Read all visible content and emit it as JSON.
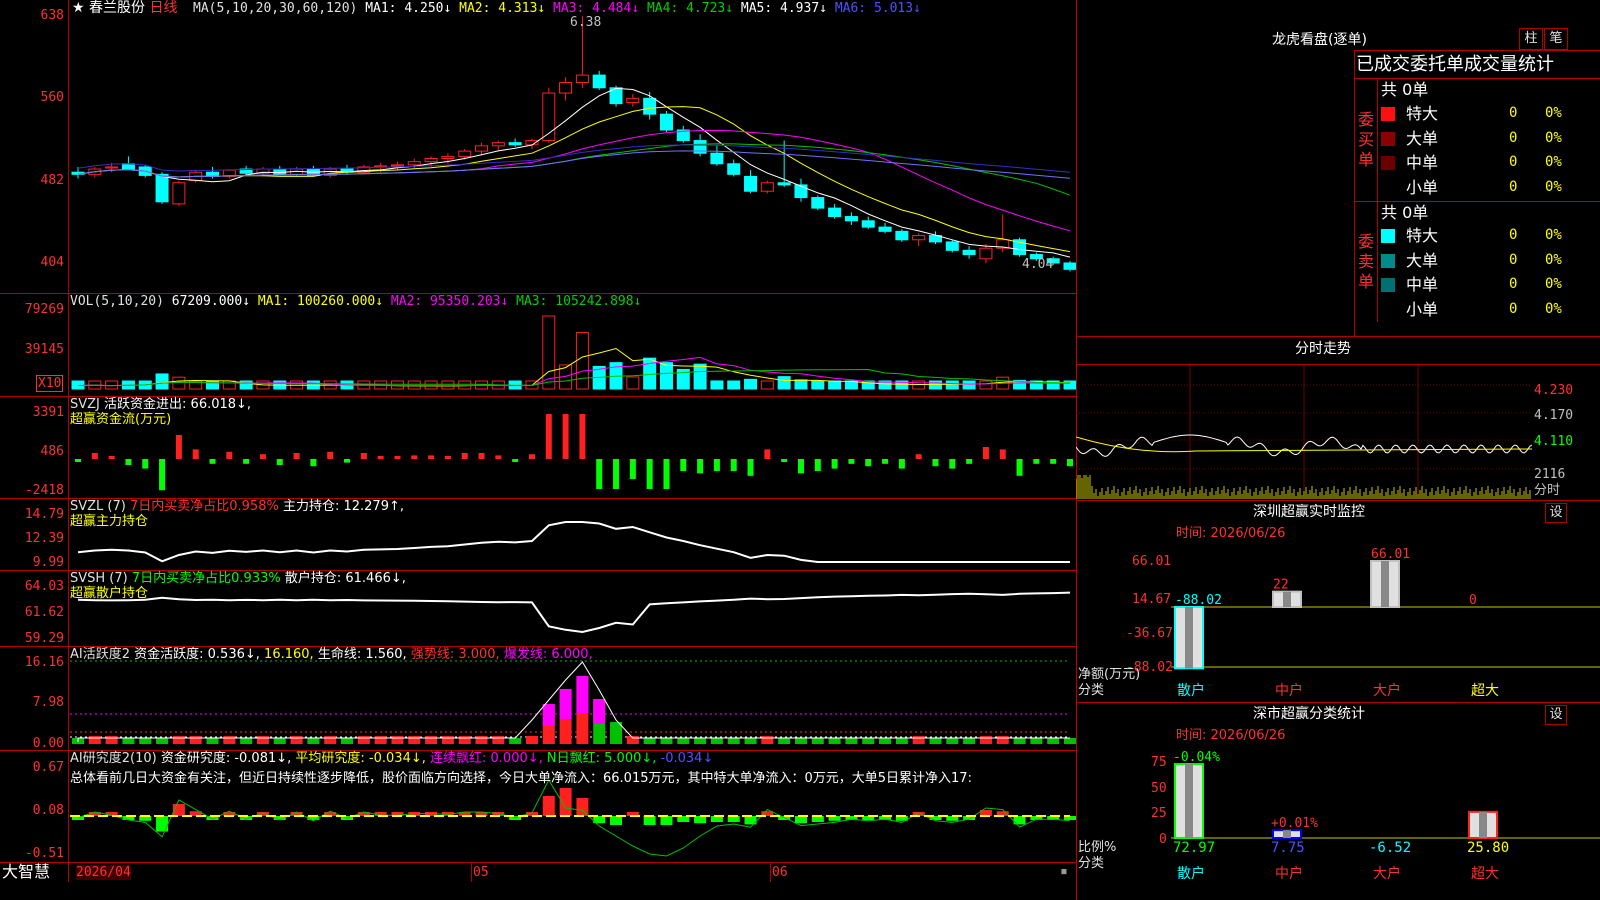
{
  "colors": {
    "up": "#ff2020",
    "down": "#00ffff",
    "ma1": "#ffffff",
    "ma2": "#ffff00",
    "ma3": "#ff00ff",
    "ma4": "#00c000",
    "ma5": "#7070ff",
    "frame": "#b00000"
  },
  "main": {
    "star": "★",
    "stock_name": "春兰股份",
    "period": "日线",
    "ma_params": "MA(5,10,20,30,60,120)",
    "ma_values": [
      "MA1: 4.250↓",
      "MA2: 4.313↓",
      "MA3: 4.484↓",
      "MA4: 4.723↓",
      "MA5: 4.937↓",
      "MA6: 5.013↓"
    ],
    "high_label": "6.38",
    "low_label": "4.04",
    "yticks": [
      "638",
      "560",
      "482",
      "404"
    ]
  },
  "vol": {
    "title": "VOL(5,10,20)",
    "value": "67209.000↓",
    "ma": [
      "MA1: 100260.000↓",
      "MA2: 95350.203↓",
      "MA3: 105242.898↓"
    ],
    "yticks": [
      "79269",
      "39145"
    ],
    "multiplier": "X10"
  },
  "svzj": {
    "title": "SVZJ",
    "label": "活跃资金进出: 66.018↓,",
    "sub": "超赢资金流(万元)",
    "yticks": [
      "3391",
      "486",
      "-2418"
    ]
  },
  "svzl": {
    "title": "SVZL (7)",
    "ratio": "7日内买卖净占比0.958%",
    "label": "主力持仓: 12.279↑,",
    "sub": "超赢主力持仓",
    "yticks": [
      "14.79",
      "12.39",
      "9.99"
    ]
  },
  "svsh": {
    "title": "SVSH (7)",
    "ratio": "7日内买卖净占比0.933%",
    "label": "散户持仓: 61.466↓,",
    "sub": "超赢散户持仓",
    "yticks": [
      "64.03",
      "61.62",
      "59.29"
    ]
  },
  "ai_active": {
    "title": "AI活跃度2",
    "label": "资金活跃度: 0.536↓,",
    "v2": "16.160,",
    "life": "生命线: 1.560,",
    "strong": "强势线: 3.000,",
    "burst": "爆发线: 6.000,",
    "yticks": [
      "16.16",
      "7.98",
      "0.00"
    ]
  },
  "ai_research": {
    "title": "AI研究度2(10)",
    "label": "资金研究度: -0.081↓,",
    "avg": "平均研究度: -0.034↓,",
    "cont": "连续飘红: 0.000↓,",
    "nday": "N日飘红: 5.000↓,",
    "last": "-0.034↓",
    "summary": "总体看前几日大资金有关注，但近日持续性逐步降低，股价面临方向选择，今日大单净流入：66.015万元，其中特大单净流入：0万元，大单5日累计净入17:",
    "yticks": [
      "0.67",
      "0.08",
      "-0.51"
    ]
  },
  "bottom": {
    "brand": "大智慧",
    "date": "2026/04",
    "m1": "05",
    "m2": "06"
  },
  "right": {
    "lhb_title": "龙虎看盘(逐单)",
    "btn1": "柱",
    "btn2": "笔",
    "tabs": "已成交委托单成交量统计",
    "buy_label": "委买单",
    "sell_label": "委卖单",
    "buy_total": "共 0单",
    "sell_total": "共 0单",
    "buy_rows": [
      {
        "name": "特大",
        "count": "0",
        "pct": "0%"
      },
      {
        "name": "大单",
        "count": "0",
        "pct": "0%"
      },
      {
        "name": "中单",
        "count": "0",
        "pct": "0%"
      },
      {
        "name": "小单",
        "count": "0",
        "pct": "0%"
      }
    ],
    "sell_rows": [
      {
        "name": "特大",
        "count": "0",
        "pct": "0%"
      },
      {
        "name": "大单",
        "count": "0",
        "pct": "0%"
      },
      {
        "name": "中单",
        "count": "0",
        "pct": "0%"
      },
      {
        "name": "小单",
        "count": "0",
        "pct": "0%"
      }
    ],
    "fs_title": "分时走势",
    "fs_yticks": [
      "4.230",
      "4.170",
      "4.110"
    ],
    "fs_vol": "2116",
    "fs_vol_label": "分时",
    "sz_title": "深圳超赢实时监控",
    "set": "设",
    "sz_time": "时间: 2026/06/26",
    "sz_yticks": [
      "66.01",
      "14.67",
      "-36.67",
      "-88.02"
    ],
    "sz_ylabel": "净额(万元)",
    "sz_xlabel": "分类",
    "sz_cats": [
      "散户",
      "中户",
      "大户",
      "超大"
    ],
    "sz_values": [
      -88.02,
      22,
      66.01,
      0
    ],
    "sz_value_labels": [
      "-88.02",
      "22",
      "66.01",
      "0"
    ],
    "fl_title": "深市超赢分类统计",
    "fl_time": "时间: 2026/06/26",
    "fl_yticks": [
      "75",
      "50",
      "25",
      "0"
    ],
    "fl_ylabel": "比例%",
    "fl_xlabel": "分类",
    "fl_cats": [
      "散户",
      "中户",
      "大户",
      "超大"
    ],
    "fl_values": [
      72.97,
      7.75,
      -6.52,
      25.8
    ],
    "fl_value_labels": [
      "72.97",
      "7.75",
      "-6.52",
      "25.80"
    ],
    "fl_top_labels": [
      "-0.04%",
      "+0.01%",
      "",
      ""
    ]
  },
  "chart_data": {
    "type": "candlestick",
    "price_axis_ticks": [
      6.38,
      5.6,
      4.82,
      4.04
    ],
    "candles_ohlc": [
      [
        4.9,
        4.95,
        4.84,
        4.88
      ],
      [
        4.88,
        4.95,
        4.85,
        4.93
      ],
      [
        4.94,
        4.99,
        4.9,
        4.95
      ],
      [
        4.98,
        5.05,
        4.92,
        4.93
      ],
      [
        4.95,
        4.97,
        4.85,
        4.87
      ],
      [
        4.88,
        4.9,
        4.6,
        4.62
      ],
      [
        4.6,
        4.82,
        4.58,
        4.8
      ],
      [
        4.82,
        4.92,
        4.8,
        4.9
      ],
      [
        4.9,
        4.95,
        4.84,
        4.86
      ],
      [
        4.86,
        4.93,
        4.84,
        4.92
      ],
      [
        4.93,
        4.96,
        4.87,
        4.89
      ],
      [
        4.89,
        4.95,
        4.86,
        4.93
      ],
      [
        4.93,
        4.96,
        4.87,
        4.88
      ],
      [
        4.88,
        4.95,
        4.86,
        4.93
      ],
      [
        4.93,
        4.96,
        4.86,
        4.87
      ],
      [
        4.87,
        4.95,
        4.85,
        4.93
      ],
      [
        4.93,
        4.97,
        4.88,
        4.9
      ],
      [
        4.9,
        4.97,
        4.88,
        4.95
      ],
      [
        4.95,
        4.99,
        4.9,
        4.96
      ],
      [
        4.96,
        5.0,
        4.92,
        4.97
      ],
      [
        4.97,
        5.03,
        4.94,
        5.0
      ],
      [
        5.0,
        5.05,
        4.95,
        5.03
      ],
      [
        5.03,
        5.08,
        4.98,
        5.05
      ],
      [
        5.05,
        5.12,
        5.02,
        5.1
      ],
      [
        5.1,
        5.18,
        5.06,
        5.15
      ],
      [
        5.15,
        5.2,
        5.1,
        5.18
      ],
      [
        5.18,
        5.22,
        5.14,
        5.16
      ],
      [
        5.16,
        5.22,
        5.12,
        5.2
      ],
      [
        5.2,
        5.7,
        5.18,
        5.65
      ],
      [
        5.65,
        5.8,
        5.58,
        5.75
      ],
      [
        5.75,
        6.38,
        5.7,
        5.82
      ],
      [
        5.82,
        5.86,
        5.68,
        5.7
      ],
      [
        5.7,
        5.72,
        5.52,
        5.55
      ],
      [
        5.56,
        5.64,
        5.52,
        5.6
      ],
      [
        5.6,
        5.66,
        5.4,
        5.45
      ],
      [
        5.45,
        5.48,
        5.28,
        5.3
      ],
      [
        5.3,
        5.34,
        5.18,
        5.2
      ],
      [
        5.2,
        5.26,
        5.05,
        5.08
      ],
      [
        5.08,
        5.16,
        4.96,
        4.98
      ],
      [
        4.98,
        5.02,
        4.86,
        4.88
      ],
      [
        4.86,
        4.92,
        4.7,
        4.72
      ],
      [
        4.72,
        4.82,
        4.7,
        4.8
      ],
      [
        4.8,
        5.2,
        4.76,
        4.78
      ],
      [
        4.78,
        4.84,
        4.62,
        4.66
      ],
      [
        4.66,
        4.68,
        4.54,
        4.56
      ],
      [
        4.56,
        4.6,
        4.46,
        4.48
      ],
      [
        4.48,
        4.52,
        4.4,
        4.44
      ],
      [
        4.44,
        4.48,
        4.36,
        4.38
      ],
      [
        4.38,
        4.42,
        4.32,
        4.34
      ],
      [
        4.34,
        4.36,
        4.24,
        4.26
      ],
      [
        4.26,
        4.32,
        4.2,
        4.3
      ],
      [
        4.3,
        4.34,
        4.22,
        4.24
      ],
      [
        4.24,
        4.26,
        4.14,
        4.16
      ],
      [
        4.16,
        4.2,
        4.08,
        4.12
      ],
      [
        4.08,
        4.22,
        4.04,
        4.18
      ],
      [
        4.18,
        4.5,
        4.14,
        4.26
      ],
      [
        4.26,
        4.28,
        4.1,
        4.12
      ],
      [
        4.12,
        4.14,
        4.06,
        4.08
      ],
      [
        4.08,
        4.1,
        4.02,
        4.04
      ],
      [
        4.04,
        4.06,
        3.96,
        3.98
      ]
    ]
  }
}
